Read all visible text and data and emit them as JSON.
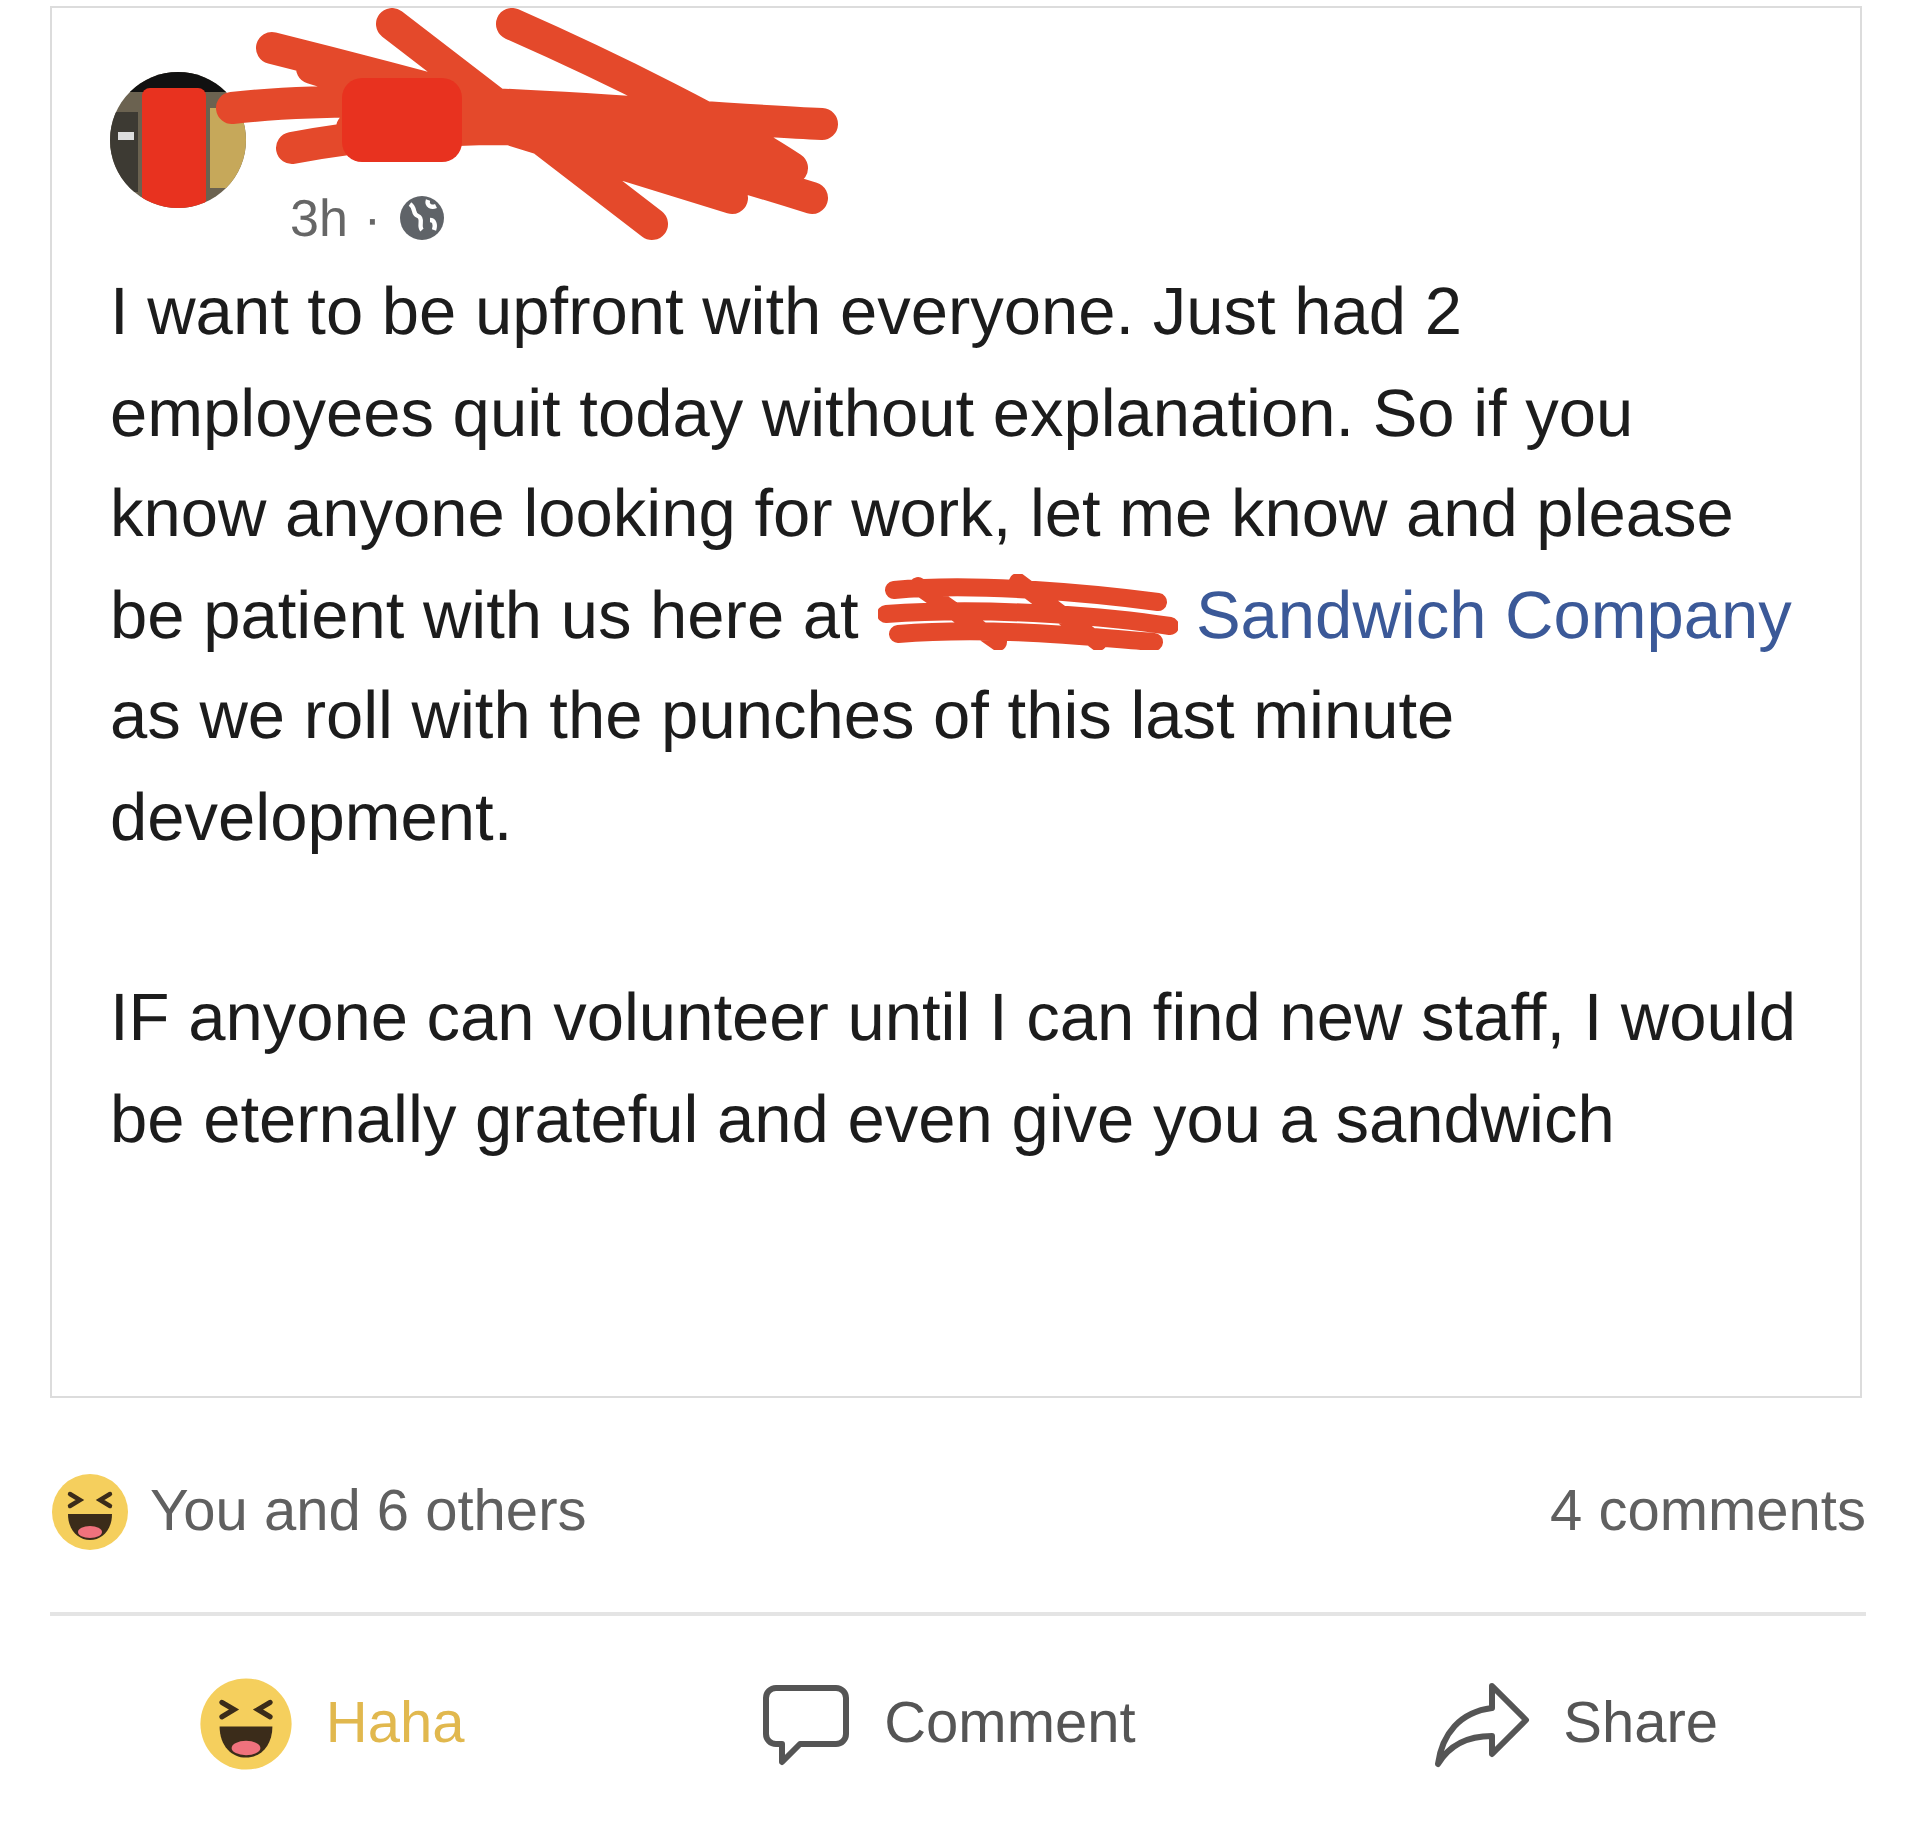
{
  "post": {
    "time": "3h",
    "separator": "·",
    "paragraphs": [
      {
        "before": "I want to be upfront with everyone. Just had 2 employees quit today without explanation. So if you know anyone looking for work, let me know and please be patient with us here at",
        "link": "Sandwich Company",
        "after": "as we roll with the punches of this last minute development."
      },
      {
        "before": "IF anyone can volunteer until I can find new staff, I would be eternally grateful and even give you a sandwich"
      }
    ]
  },
  "reactions": {
    "summary": "You and 6 others",
    "comments": "4 comments"
  },
  "actions": [
    {
      "kind": "haha",
      "label": "Haha",
      "selected": true
    },
    {
      "kind": "comment",
      "label": "Comment",
      "selected": false
    },
    {
      "kind": "share",
      "label": "Share",
      "selected": false
    }
  ]
}
